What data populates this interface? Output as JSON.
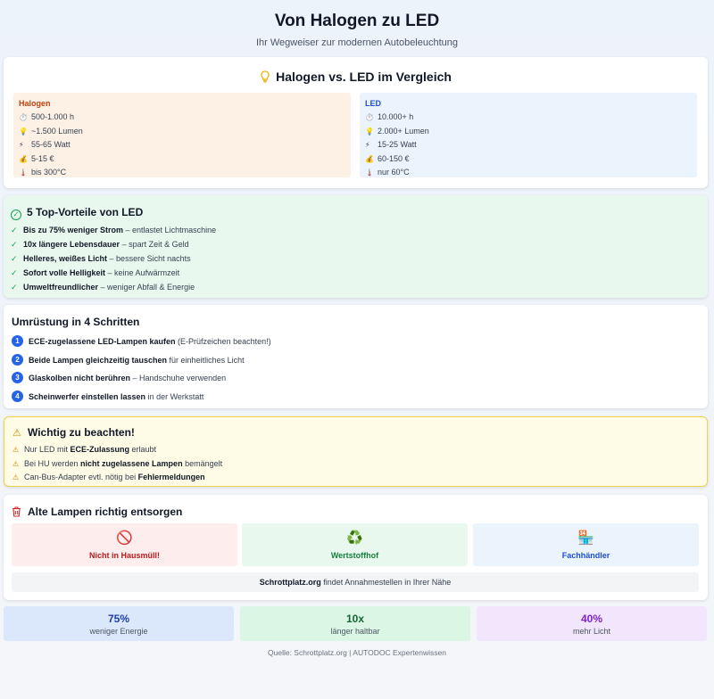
{
  "header": {
    "title": "Von Halogen zu LED",
    "subtitle": "Ihr Wegweiser zur modernen Autobeleuchtung"
  },
  "comparison": {
    "title": "Halogen vs. LED im Vergleich",
    "icon": "lightbulb-icon",
    "halogen": {
      "title": "Halogen",
      "color": "#c2410c",
      "specs": [
        {
          "icon": "⏱️",
          "text": "500-1.000 h"
        },
        {
          "icon": "💡",
          "text": "~1.500 Lumen"
        },
        {
          "icon": "⚡",
          "text": "55-65 Watt"
        },
        {
          "icon": "💰",
          "text": "5-15 €"
        },
        {
          "icon": "🌡️",
          "text": "bis 300°C"
        }
      ]
    },
    "led": {
      "title": "LED",
      "color": "#1d4ed8",
      "specs": [
        {
          "icon": "⏱️",
          "text": "10.000+ h"
        },
        {
          "icon": "💡",
          "text": "2.000+ Lumen"
        },
        {
          "icon": "⚡",
          "text": "15-25 Watt"
        },
        {
          "icon": "💰",
          "text": "60-150 €"
        },
        {
          "icon": "🌡️",
          "text": "nur 60°C"
        }
      ]
    }
  },
  "advantages": {
    "title": "5 Top-Vorteile von LED",
    "items": [
      {
        "bold": "Bis zu 75% weniger Strom",
        "rest": " – entlastet Lichtmaschine"
      },
      {
        "bold": "10x längere Lebensdauer",
        "rest": " – spart Zeit & Geld"
      },
      {
        "bold": "Helleres, weißes Licht",
        "rest": " – bessere Sicht nachts"
      },
      {
        "bold": "Sofort volle Helligkeit",
        "rest": " – keine Aufwärmzeit"
      },
      {
        "bold": "Umweltfreundlicher",
        "rest": " – weniger Abfall & Energie"
      }
    ]
  },
  "steps": {
    "title": "Umrüstung in 4 Schritten",
    "items": [
      {
        "num": "1",
        "bold": "ECE-zugelassene LED-Lampen kaufen",
        "rest": " (E-Prüfzeichen beachten!)"
      },
      {
        "num": "2",
        "bold": "Beide Lampen gleichzeitig tauschen",
        "rest": " für einheitliches Licht"
      },
      {
        "num": "3",
        "bold": "Glaskolben nicht berühren",
        "rest": " – Handschuhe verwenden"
      },
      {
        "num": "4",
        "bold": "Scheinwerfer einstellen lassen",
        "rest": " in der Werkstatt"
      }
    ]
  },
  "warning": {
    "title": "Wichtig zu beachten!",
    "items": [
      {
        "pre": "Nur LED mit ",
        "bold": "ECE-Zulassung",
        "post": " erlaubt"
      },
      {
        "pre": "Bei HU werden ",
        "bold": "nicht zugelassene Lampen",
        "post": " bemängelt"
      },
      {
        "pre": "Can-Bus-Adapter evtl. nötig bei ",
        "bold": "Fehlermeldungen",
        "post": ""
      }
    ]
  },
  "disposal": {
    "title": "Alte Lampen richtig entsorgen",
    "tiles": [
      {
        "icon": "🚫",
        "label": "Nicht in Hausmüll!"
      },
      {
        "icon": "♻️",
        "label": "Wertstoffhof"
      },
      {
        "icon": "🏪",
        "label": "Fachhändler"
      }
    ],
    "note_bold": "Schrottplatz.org",
    "note_rest": " findet Annahmestellen in Ihrer Nähe"
  },
  "stats": [
    {
      "value": "75%",
      "label": "weniger Energie"
    },
    {
      "value": "10x",
      "label": "länger haltbar"
    },
    {
      "value": "40%",
      "label": "mehr Licht"
    }
  ],
  "source": "Quelle: Schrottplatz.org | AUTODOC Expertenwissen"
}
